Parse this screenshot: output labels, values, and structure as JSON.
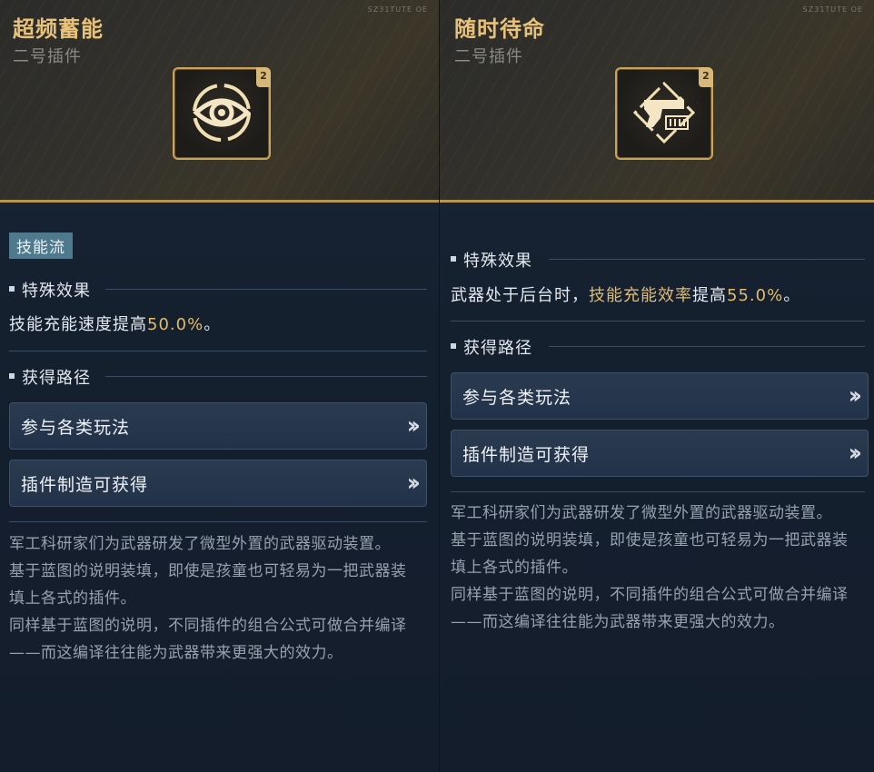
{
  "left": {
    "title": "超频蓄能",
    "subtitle": "二号插件",
    "corner_mark": "SZ31TUTE  OE",
    "icon": {
      "name": "eye-icon",
      "slot": "2"
    },
    "tag": "技能流",
    "effect": {
      "heading": "特殊效果",
      "prefix": "技能充能速度提高",
      "highlight": "",
      "middle": "",
      "value": "50.0%",
      "suffix": "。"
    },
    "sources": {
      "heading": "获得路径",
      "items": [
        {
          "label": "参与各类玩法"
        },
        {
          "label": "插件制造可获得"
        }
      ]
    },
    "description": [
      "军工科研家们为武器研发了微型外置的武器驱动装置。",
      "基于蓝图的说明装填，即使是孩童也可轻易为一把武器装填上各式的插件。",
      "同样基于蓝图的说明，不同插件的组合公式可做合并编译——而这编译往往能为武器带来更强大的效力。"
    ]
  },
  "right": {
    "title": "随时待命",
    "subtitle": "二号插件",
    "corner_mark": "SZ31TUTE  OE",
    "icon": {
      "name": "gun-icon",
      "slot": "2"
    },
    "effect": {
      "heading": "特殊效果",
      "prefix": "武器处于后台时，",
      "highlight": "技能充能效率",
      "middle": "提高",
      "value": "55.0%",
      "suffix": "。"
    },
    "sources": {
      "heading": "获得路径",
      "items": [
        {
          "label": "参与各类玩法"
        },
        {
          "label": "插件制造可获得"
        }
      ]
    },
    "description": [
      "军工科研家们为武器研发了微型外置的武器驱动装置。",
      "基于蓝图的说明装填，即使是孩童也可轻易为一把武器装填上各式的插件。",
      "同样基于蓝图的说明，不同插件的组合公式可做合并编译——而这编译往往能为武器带来更强大的效力。"
    ]
  },
  "colors": {
    "accent_gold": "#e0bb6f",
    "title_gold": "#e9c27a",
    "tag_bg": "#4f7a8e",
    "panel_bg": "#15202f"
  }
}
